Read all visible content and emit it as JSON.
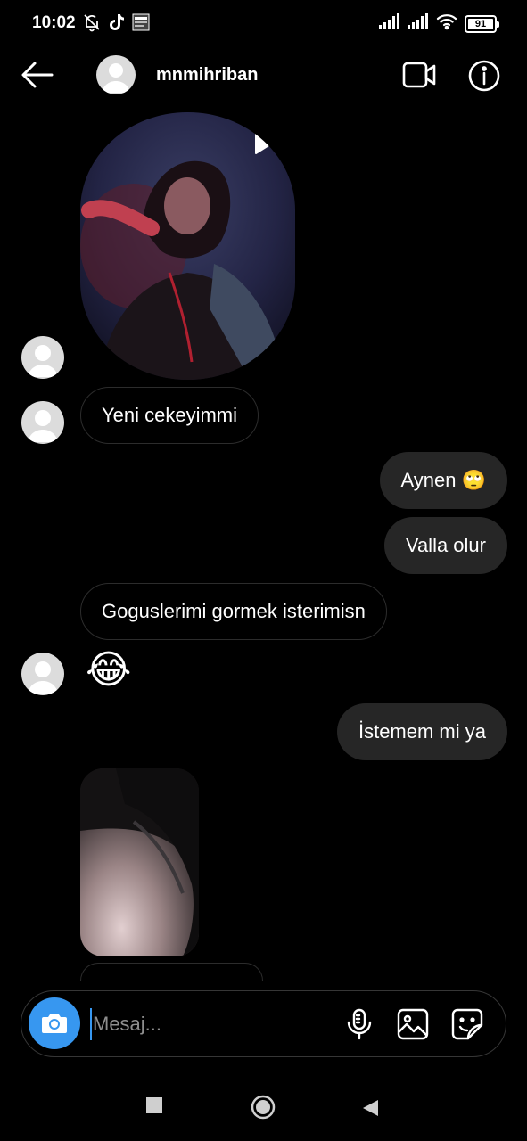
{
  "status_bar": {
    "time": "10:02",
    "battery": "91",
    "battery_level": 0.91,
    "icons": [
      "bell-off-icon",
      "tiktok-icon",
      "news-thumbnail-icon",
      "signal-icon",
      "signal-icon",
      "wifi-icon",
      "battery-icon"
    ]
  },
  "header": {
    "username": "mnmihriban",
    "back_icon": "back-arrow-icon",
    "video_icon": "video-call-icon",
    "info_icon": "info-icon"
  },
  "messages": [
    {
      "type": "video",
      "direction": "in",
      "icon": "play-icon"
    },
    {
      "type": "text",
      "direction": "in",
      "text": "Yeni cekeyimmi"
    },
    {
      "type": "text",
      "direction": "out",
      "text": "Aynen 🙄"
    },
    {
      "type": "text",
      "direction": "out",
      "text": "Valla olur"
    },
    {
      "type": "text",
      "direction": "in",
      "text": "Goguslerimi gormek isterimisn"
    },
    {
      "type": "emoji",
      "direction": "in",
      "text": "😂"
    },
    {
      "type": "text",
      "direction": "out",
      "text": "İstemem mi ya"
    },
    {
      "type": "image",
      "direction": "in"
    }
  ],
  "composer": {
    "placeholder": "Mesaj...",
    "value": "",
    "camera_icon": "camera-icon",
    "mic_icon": "microphone-icon",
    "gallery_icon": "gallery-icon",
    "sticker_icon": "sticker-icon"
  },
  "nav_bar": {
    "icons": [
      "recents-square-icon",
      "home-circle-icon",
      "back-triangle-icon"
    ]
  },
  "colors": {
    "background": "#000000",
    "outgoing_bubble": "#262626",
    "incoming_border": "#2c2c2c",
    "accent": "#3797f0",
    "placeholder": "#8e8e8e"
  }
}
